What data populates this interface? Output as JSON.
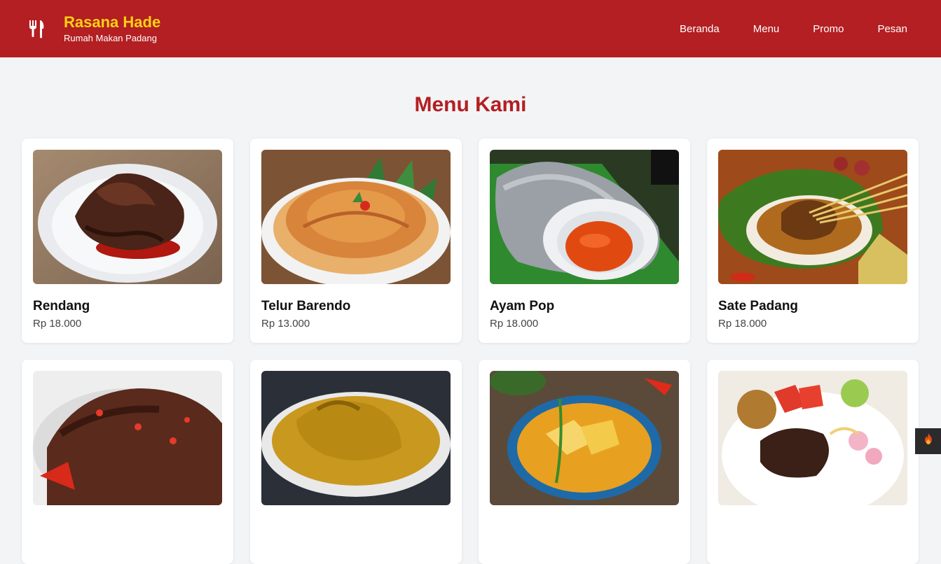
{
  "brand": {
    "title": "Rasana Hade",
    "subtitle": "Rumah Makan Padang",
    "icon": "utensils-icon"
  },
  "nav": {
    "items": [
      {
        "label": "Beranda"
      },
      {
        "label": "Menu"
      },
      {
        "label": "Promo"
      },
      {
        "label": "Pesan"
      }
    ]
  },
  "main": {
    "title": "Menu Kami"
  },
  "menu_items": [
    {
      "name": "Rendang",
      "price": "Rp 18.000"
    },
    {
      "name": "Telur Barendo",
      "price": "Rp 13.000"
    },
    {
      "name": "Ayam Pop",
      "price": "Rp 18.000"
    },
    {
      "name": "Sate Padang",
      "price": "Rp 18.000"
    },
    {
      "name": "",
      "price": ""
    },
    {
      "name": "",
      "price": ""
    },
    {
      "name": "",
      "price": ""
    },
    {
      "name": "",
      "price": ""
    }
  ],
  "floating_button": {
    "icon": "fire-icon"
  },
  "colors": {
    "header_bg": "#b31f22",
    "brand_title": "#fcd116",
    "page_bg": "#f3f4f6",
    "accent": "#b31f22"
  }
}
